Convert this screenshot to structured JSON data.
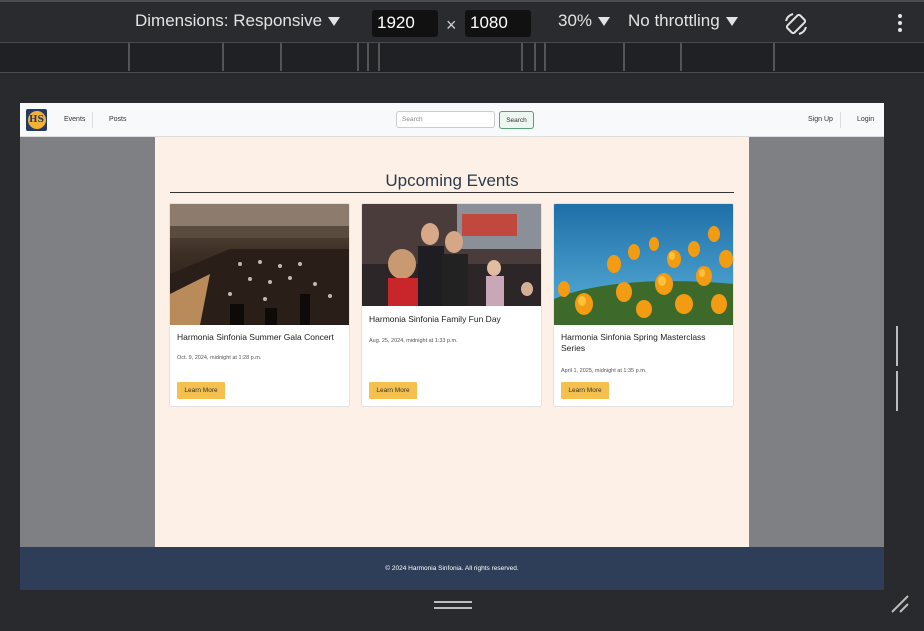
{
  "devtools": {
    "dimensions_label": "Dimensions: Responsive",
    "width_value": "1920",
    "times_sign": "×",
    "height_value": "1080",
    "zoom_label": "30%",
    "throttling_label": "No throttling",
    "rotate_icon": "rotate-icon",
    "more_icon": "kebab-menu-icon"
  },
  "site": {
    "logo_text": "HS",
    "nav": {
      "events": "Events",
      "posts": "Posts",
      "search_placeholder": "Search",
      "search_button": "Search",
      "signup": "Sign Up",
      "login": "Login"
    },
    "heading": "Upcoming Events",
    "events": [
      {
        "title": "Harmonia Sinfonia Summer Gala Concert",
        "date": "Oct. 9, 2024, midnight at 1:28 p.m.",
        "button": "Learn More"
      },
      {
        "title": "Harmonia Sinfonia Family Fun Day",
        "date": "Aug. 25, 2024, midnight at 1:33 p.m.",
        "button": "Learn More"
      },
      {
        "title": "Harmonia Sinfonia Spring Masterclass Series",
        "date": "April 1, 2025, midnight at 1:35 p.m.",
        "button": "Learn More"
      }
    ],
    "footer": "© 2024 Harmonia Sinfonia. All rights reserved."
  },
  "colors": {
    "navbar": "#f8f9fa",
    "content_bg": "#fdf1e7",
    "footer_bg": "#2e3e58",
    "button_accent": "#f4c14f",
    "devtools_bg": "#2a2b2e"
  }
}
